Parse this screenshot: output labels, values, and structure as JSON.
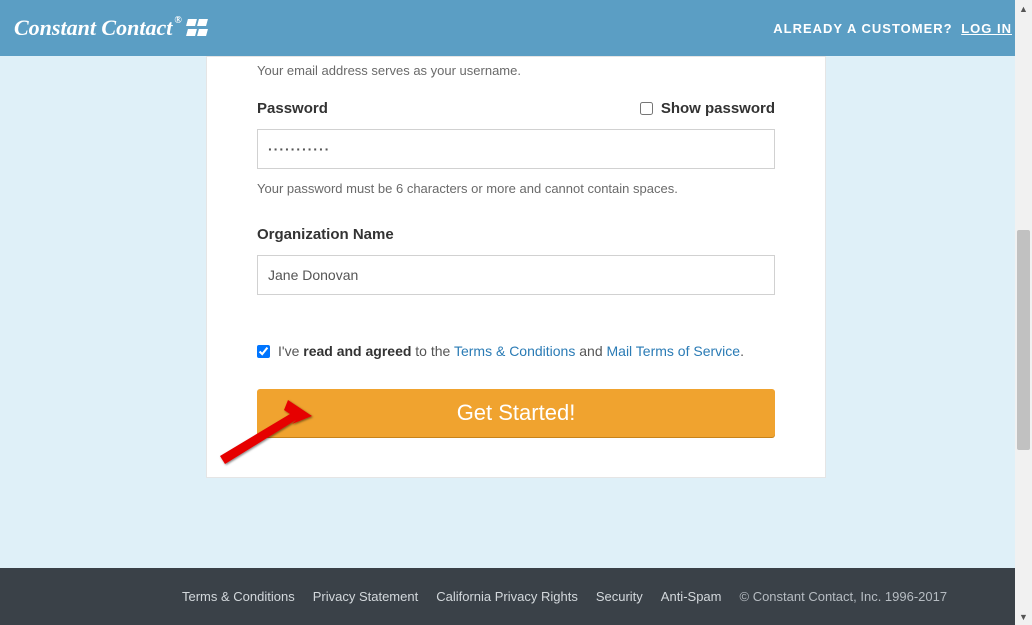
{
  "header": {
    "logo": "Constant Contact",
    "already_customer": "ALREADY A CUSTOMER?",
    "login": "LOG IN"
  },
  "email": {
    "helper": "Your email address serves as your username."
  },
  "password": {
    "label": "Password",
    "show_label": "Show password",
    "value": "···········",
    "helper": "Your password must be 6 characters or more and cannot contain spaces."
  },
  "org": {
    "label": "Organization Name",
    "value": "Jane Donovan"
  },
  "agree": {
    "prefix": "I've",
    "strong": "read and agreed",
    "mid": "to the",
    "tc": "Terms & Conditions",
    "and": "and",
    "mtos": "Mail Terms of Service",
    "suffix": "."
  },
  "cta": "Get Started!",
  "footer": {
    "tc": "Terms & Conditions",
    "ps": "Privacy Statement",
    "cpr": "California Privacy Rights",
    "sec": "Security",
    "as": "Anti-Spam",
    "copy": "© Constant Contact, Inc. 1996-2017"
  }
}
